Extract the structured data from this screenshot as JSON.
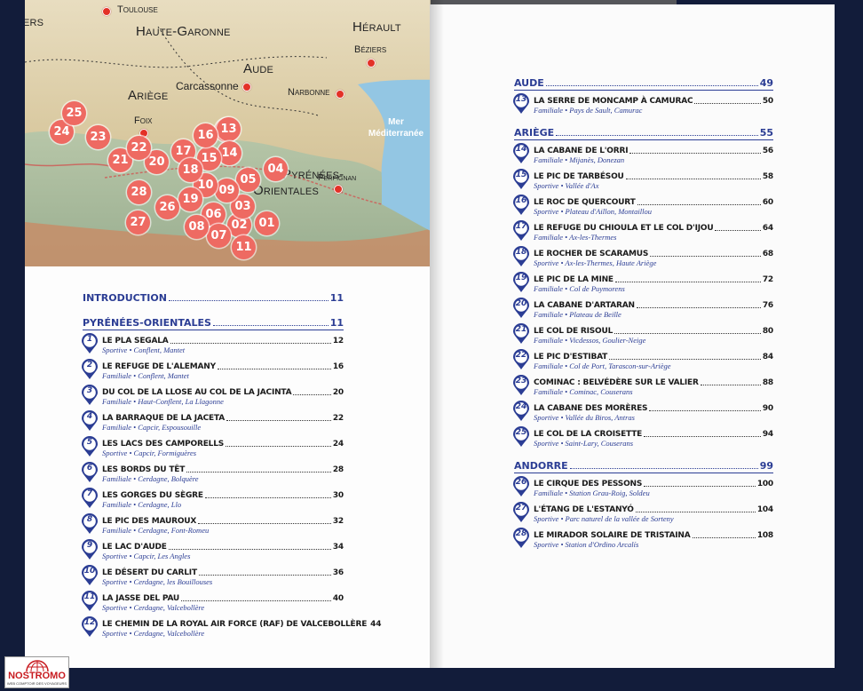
{
  "map": {
    "departments": {
      "haute_garonne": "Haute-Garonne",
      "herault": "Hérault",
      "aude": "Aude",
      "ariege": "Ariège",
      "pyrenees_orientales_a": "Pyrénées-",
      "pyrenees_orientales_b": "Orientales",
      "left_partial": "ers"
    },
    "cities": {
      "toulouse": "Toulouse",
      "beziers": "Béziers",
      "carcassonne": "Carcassonne",
      "narbonne": "Narbonne",
      "foix": "Foix",
      "perpignan": "Perpignan"
    },
    "sea": {
      "line1": "Mer",
      "line2": "Méditerranée"
    },
    "markers": [
      "01",
      "02",
      "03",
      "04",
      "05",
      "06",
      "07",
      "08",
      "09",
      "10",
      "11",
      "12",
      "13",
      "14",
      "15",
      "16",
      "17",
      "18",
      "19",
      "20",
      "21",
      "22",
      "23",
      "24",
      "25",
      "26",
      "27",
      "28"
    ],
    "marker_color": "#ee6a62"
  },
  "toc": {
    "accent_color": "#2b3d94",
    "left": {
      "introduction": {
        "label": "Introduction",
        "page": "11"
      },
      "section": {
        "label": "Pyrénées-Orientales",
        "page": "11"
      },
      "entries": [
        {
          "num": "1",
          "title": "Le Pla Segala",
          "page": "12",
          "sub": "Sportive • Conflent, Mantet"
        },
        {
          "num": "2",
          "title": "Le refuge de l'Alemany",
          "page": "16",
          "sub": "Familiale • Conflent, Mantet"
        },
        {
          "num": "3",
          "title": "Du col de la Llose au col de la Jacinta",
          "page": "20",
          "sub": "Familiale • Haut-Conflent, La Llagonne"
        },
        {
          "num": "4",
          "title": "La barraque de la Jaceta",
          "page": "22",
          "sub": "Familiale • Capcir, Espousouille"
        },
        {
          "num": "5",
          "title": "Les lacs des Camporells",
          "page": "24",
          "sub": "Sportive • Capcir, Formiguères"
        },
        {
          "num": "6",
          "title": "Les bords du Têt",
          "page": "28",
          "sub": "Familiale • Cerdagne, Bolquère"
        },
        {
          "num": "7",
          "title": "Les gorges du Sègre",
          "page": "30",
          "sub": "Familiale • Cerdagne, Llo"
        },
        {
          "num": "8",
          "title": "Le pic des Mauroux",
          "page": "32",
          "sub": "Familiale • Cerdagne, Font-Romeu"
        },
        {
          "num": "9",
          "title": "Le lac d'Aude",
          "page": "34",
          "sub": "Sportive • Capcir, Les Angles"
        },
        {
          "num": "10",
          "title": "Le désert du Carlit",
          "page": "36",
          "sub": "Sportive • Cerdagne, les Bouillouses"
        },
        {
          "num": "11",
          "title": "La jasse del Pau",
          "page": "40",
          "sub": "Sportive • Cerdagne, Valcebollère"
        },
        {
          "num": "12",
          "title": "Le chemin de la Royal Air Force (RAF) de Valcebollère",
          "page": "44",
          "sub": "Sportive • Cerdagne, Valcebollère"
        }
      ]
    },
    "right": {
      "aude": {
        "label": "Aude",
        "page": "49",
        "entries": [
          {
            "num": "13",
            "title": "La serre de Moncamp à Camurac",
            "page": "50",
            "sub": "Familiale • Pays de Sault, Camurac"
          }
        ]
      },
      "ariege": {
        "label": "Ariège",
        "page": "55",
        "entries": [
          {
            "num": "14",
            "title": "La cabane de l'Orri",
            "page": "56",
            "sub": "Familiale • Mijanès, Donezan"
          },
          {
            "num": "15",
            "title": "Le pic de Tarbésou",
            "page": "58",
            "sub": "Sportive • Vallée d'Ax"
          },
          {
            "num": "16",
            "title": "Le roc de Quercourt",
            "page": "60",
            "sub": "Sportive • Plateau d'Aillon, Montaillou"
          },
          {
            "num": "17",
            "title": "Le refuge du Chioula et le col d'Ijou",
            "page": "64",
            "sub": "Familiale • Ax-les-Thermes"
          },
          {
            "num": "18",
            "title": "Le rocher de Scaramus",
            "page": "68",
            "sub": "Sportive • Ax-les-Thermes, Haute Ariège"
          },
          {
            "num": "19",
            "title": "Le pic de la Mine",
            "page": "72",
            "sub": "Familiale • Col de Puymorens"
          },
          {
            "num": "20",
            "title": "La cabane d'Artaran",
            "page": "76",
            "sub": "Familiale • Plateau de Beille"
          },
          {
            "num": "21",
            "title": "Le col de Risoul",
            "page": "80",
            "sub": "Familiale • Vicdessos, Goulier-Neige"
          },
          {
            "num": "22",
            "title": "Le pic d'Estibat",
            "page": "84",
            "sub": "Familiale • Col de Port, Tarascon-sur-Ariège"
          },
          {
            "num": "23",
            "title": "Cominac : belvédère sur le Valier",
            "page": "88",
            "sub": "Familiale • Cominac, Couserans"
          },
          {
            "num": "24",
            "title": "La cabane des Morères",
            "page": "90",
            "sub": "Sportive • Vallée du Biros, Antras"
          },
          {
            "num": "25",
            "title": "Le col de la Croisette",
            "page": "94",
            "sub": "Sportive • Saint-Lary, Couserans"
          }
        ]
      },
      "andorre": {
        "label": "Andorre",
        "page": "99",
        "entries": [
          {
            "num": "26",
            "title": "Le cirque des Pessons",
            "page": "100",
            "sub": "Familiale • Station Grau-Roig, Soldeu"
          },
          {
            "num": "27",
            "title": "L'étang de l'Estanyó",
            "page": "104",
            "sub": "Sportive • Parc naturel de la vallée de Sorteny"
          },
          {
            "num": "28",
            "title": "Le mirador solaire de Tristaina",
            "page": "108",
            "sub": "Sportive • Station d'Ordino Arcalís"
          }
        ]
      }
    }
  },
  "logo": {
    "name": "NOSTROMO",
    "tagline": "WEB COMPTOIR DES VOYAGEURS"
  }
}
